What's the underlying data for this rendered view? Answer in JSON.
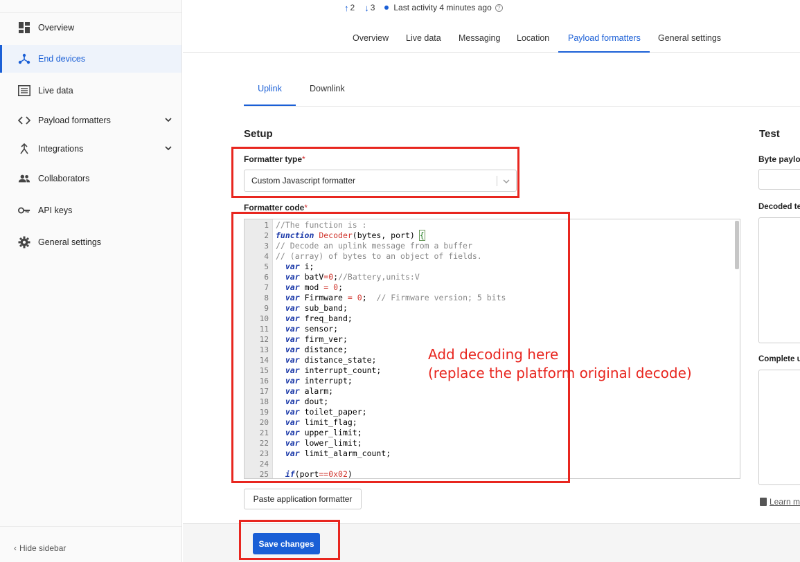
{
  "sidebar": {
    "items": [
      {
        "label": "Overview",
        "icon": "dashboard-icon"
      },
      {
        "label": "End devices",
        "icon": "devices-icon",
        "active": true
      },
      {
        "label": "Live data",
        "icon": "list-icon"
      },
      {
        "label": "Payload formatters",
        "icon": "code-icon",
        "expandable": true
      },
      {
        "label": "Integrations",
        "icon": "merge-icon",
        "expandable": true
      },
      {
        "label": "Collaborators",
        "icon": "people-icon"
      },
      {
        "label": "API keys",
        "icon": "key-icon"
      },
      {
        "label": "General settings",
        "icon": "gear-icon"
      }
    ],
    "hide_label": "Hide sidebar"
  },
  "header": {
    "uplink_count": "2",
    "downlink_count": "3",
    "last_activity": "Last activity 4 minutes ago"
  },
  "tabs": [
    "Overview",
    "Live data",
    "Messaging",
    "Location",
    "Payload formatters",
    "General settings"
  ],
  "subtabs": [
    "Uplink",
    "Downlink"
  ],
  "setup": {
    "title": "Setup",
    "formatter_type_label": "Formatter type",
    "required_mark": "*",
    "formatter_type_value": "Custom Javascript formatter",
    "formatter_code_label": "Formatter code",
    "paste_button": "Paste application formatter",
    "save_button": "Save changes"
  },
  "test": {
    "title": "Test",
    "byte_payload_label": "Byte paylo",
    "decoded_label": "Decoded te",
    "complete_label": "Complete u",
    "learn_label": "Learn m"
  },
  "code_lines": [
    "//The function is :",
    "function Decoder(bytes, port) {",
    "// Decode an uplink message from a buffer",
    "// (array) of bytes to an object of fields.",
    "  var i;",
    "  var batV=0;//Battery,units:V",
    "  var mod = 0;",
    "  var Firmware = 0;  // Firmware version; 5 bits",
    "  var sub_band;",
    "  var freq_band;",
    "  var sensor;",
    "  var firm_ver;",
    "  var distance;",
    "  var distance_state;",
    "  var interrupt_count;",
    "  var interrupt;",
    "  var alarm;",
    "  var dout;",
    "  var toilet_paper;",
    "  var limit_flag;",
    "  var upper_limit;",
    "  var lower_limit;",
    "  var limit_alarm_count;",
    "",
    "  if(port==0x02)"
  ],
  "annotation": {
    "line1": "Add decoding here",
    "line2": "(replace the platform original decode)"
  },
  "colors": {
    "accent": "#1a5fd6",
    "annotation_red": "#e8261f"
  }
}
